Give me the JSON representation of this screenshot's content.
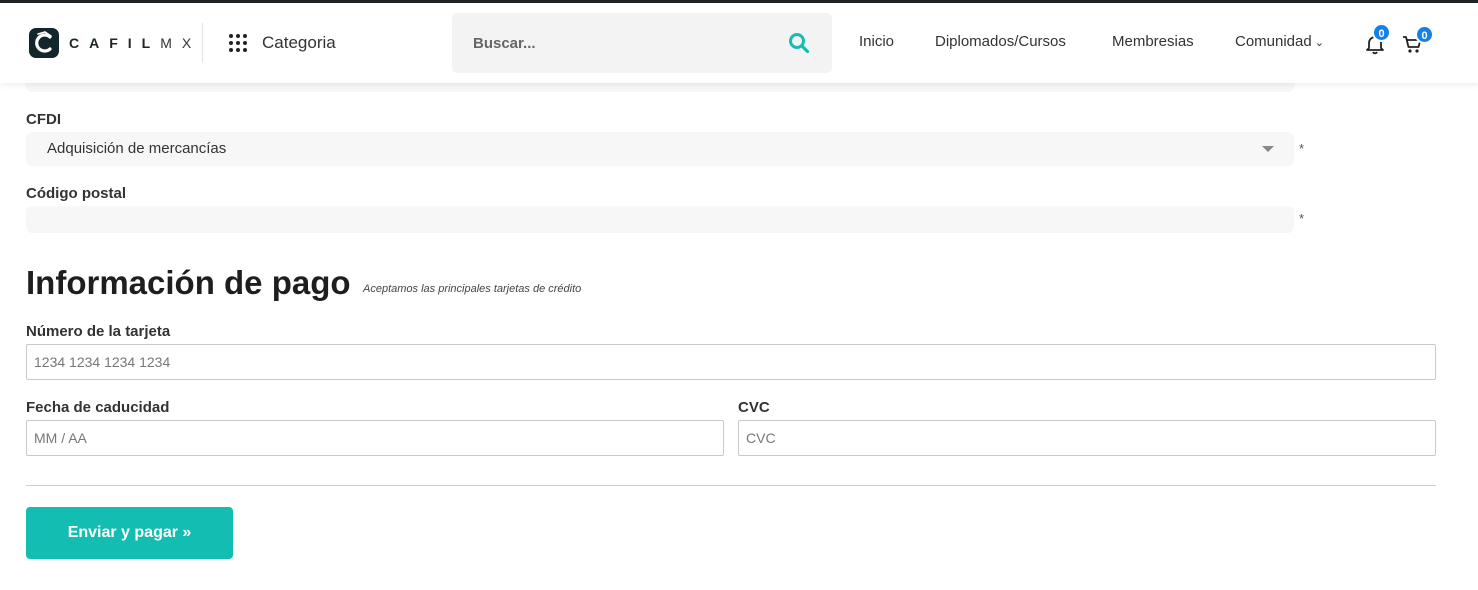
{
  "header": {
    "logo": {
      "text_bold": "CAFIL",
      "text_thin": "MX"
    },
    "category_label": "Categoria",
    "search": {
      "placeholder": "Buscar..."
    },
    "nav": {
      "inicio": "Inicio",
      "diplomados": "Diplomados/Cursos",
      "membresias": "Membresias",
      "comunidad": "Comunidad"
    },
    "notifications_count": "0",
    "cart_count": "0"
  },
  "form": {
    "cfdi": {
      "label": "CFDI",
      "value": "Adquisición de mercancías",
      "required_mark": "*"
    },
    "postal_code": {
      "label": "Código postal",
      "value": "",
      "required_mark": "*"
    },
    "partial_field_required_mark": ""
  },
  "payment": {
    "title": "Información de pago",
    "subtitle": "Aceptamos las principales tarjetas de crédito",
    "card_number": {
      "label": "Número de la tarjeta",
      "placeholder": "1234 1234 1234 1234",
      "value": ""
    },
    "expiry": {
      "label": "Fecha de caducidad",
      "placeholder": "MM / AA",
      "value": ""
    },
    "cvc": {
      "label": "CVC",
      "placeholder": "CVC",
      "value": ""
    },
    "submit_label": "Enviar y pagar »"
  },
  "colors": {
    "accent_teal": "#13bdb2",
    "badge_blue": "#1480e8",
    "logo_dark": "#12262b",
    "field_bg": "#f7f7f7"
  },
  "icons": [
    "cafil-logo-icon",
    "grid-dots-icon",
    "search-icon",
    "chevron-down-icon",
    "bell-icon",
    "cart-icon",
    "select-arrow-icon"
  ]
}
